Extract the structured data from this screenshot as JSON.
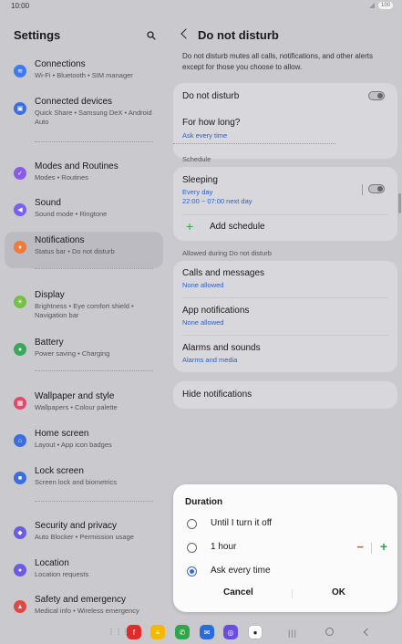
{
  "statusbar": {
    "time": "10:00",
    "battery": "100"
  },
  "left": {
    "title": "Settings",
    "items": [
      {
        "label": "Connections",
        "sub": "Wi-Fi  •  Bluetooth  •  SIM manager",
        "color": "#3d7bf2",
        "icon": "wifi-icon",
        "glyph": "≋"
      },
      {
        "label": "Connected devices",
        "sub": "Quick Share  •  Samsung DeX  •  Android Auto",
        "color": "#3b6fe0",
        "icon": "connected-devices-icon",
        "glyph": "▣"
      },
      {
        "label": "Modes and Routines",
        "sub": "Modes  •  Routines",
        "color": "#8a5be6",
        "icon": "modes-icon",
        "glyph": "✓"
      },
      {
        "label": "Sound",
        "sub": "Sound mode  •  Ringtone",
        "color": "#7a5ff0",
        "icon": "sound-icon",
        "glyph": "◀"
      },
      {
        "label": "Notifications",
        "sub": "Status bar  •  Do not disturb",
        "color": "#f07a3a",
        "icon": "notifications-icon",
        "glyph": "♦"
      },
      {
        "label": "Display",
        "sub": "Brightness  •  Eye comfort shield  •  Navigation bar",
        "color": "#76c043",
        "icon": "display-icon",
        "glyph": "☀"
      },
      {
        "label": "Battery",
        "sub": "Power saving  •  Charging",
        "color": "#3aa85a",
        "icon": "battery-icon",
        "glyph": "●"
      },
      {
        "label": "Wallpaper and style",
        "sub": "Wallpapers  •  Colour palette",
        "color": "#e2486a",
        "icon": "wallpaper-icon",
        "glyph": "▦"
      },
      {
        "label": "Home screen",
        "sub": "Layout  •  App icon badges",
        "color": "#3b6fe0",
        "icon": "home-screen-icon",
        "glyph": "⌂"
      },
      {
        "label": "Lock screen",
        "sub": "Screen lock and biometrics",
        "color": "#3b6fe0",
        "icon": "lock-icon",
        "glyph": "■"
      },
      {
        "label": "Security and privacy",
        "sub": "Auto Blocker  •  Permission usage",
        "color": "#6b5ce0",
        "icon": "security-icon",
        "glyph": "◆"
      },
      {
        "label": "Location",
        "sub": "Location requests",
        "color": "#6b5ce0",
        "icon": "location-icon",
        "glyph": "●"
      },
      {
        "label": "Safety and emergency",
        "sub": "Medical info  •  Wireless emergency",
        "color": "#e04848",
        "icon": "safety-icon",
        "glyph": "▲"
      }
    ]
  },
  "right": {
    "title": "Do not disturb",
    "description": "Do not disturb mutes all calls, notifications, and other alerts except for those you choose to allow.",
    "dnd_label": "Do not disturb",
    "how_long_label": "For how long?",
    "how_long_value": "Ask every time",
    "schedule_section": "Schedule",
    "sleeping_label": "Sleeping",
    "sleeping_days": "Every day",
    "sleeping_time": "22:00 ~ 07:00 next day",
    "add_schedule": "Add schedule",
    "allowed_section": "Allowed during Do not disturb",
    "calls_label": "Calls and messages",
    "calls_value": "None allowed",
    "apps_label": "App notifications",
    "apps_value": "None allowed",
    "alarms_label": "Alarms and sounds",
    "alarms_value": "Alarms and media",
    "hide_label": "Hide notifications"
  },
  "dialog": {
    "title": "Duration",
    "options": [
      "Until I turn it off",
      "1 hour",
      "Ask every time"
    ],
    "selected_index": 2,
    "cancel": "Cancel",
    "ok": "OK"
  },
  "navbar": {
    "apps": [
      {
        "name": "flipboard-app-icon",
        "color": "#e02b2b",
        "glyph": "f"
      },
      {
        "name": "notes-app-icon",
        "color": "#f5b800",
        "glyph": "≡"
      },
      {
        "name": "phone-app-icon",
        "color": "#2fa64a",
        "glyph": "✆"
      },
      {
        "name": "messages-app-icon",
        "color": "#2b6be0",
        "glyph": "✉"
      },
      {
        "name": "internet-app-icon",
        "color": "#6b4be0",
        "glyph": "◎"
      },
      {
        "name": "camera-app-icon",
        "color": "#ffffff",
        "glyph": "●"
      }
    ]
  }
}
